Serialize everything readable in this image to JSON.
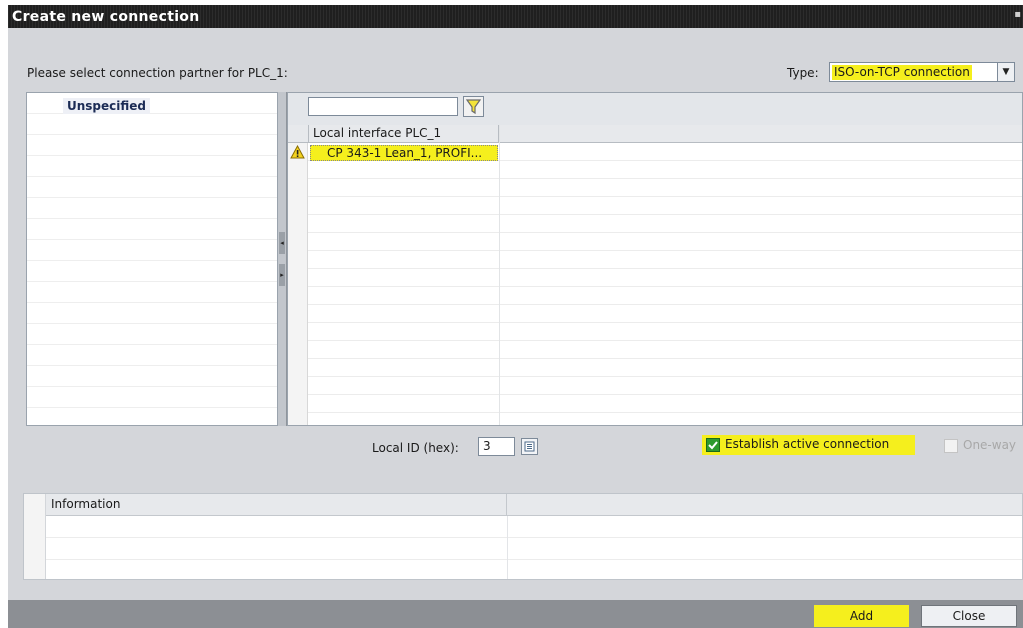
{
  "window": {
    "title": "Create new connection"
  },
  "header": {
    "prompt": "Please select connection partner for PLC_1:",
    "type_label": "Type:",
    "type_value": "ISO-on-TCP connection"
  },
  "partners": {
    "items": [
      {
        "label": "Unspecified"
      }
    ]
  },
  "interfaces": {
    "filter_value": "",
    "column_header": "Local interface PLC_1",
    "rows": [
      {
        "label": "CP 343-1 Lean_1, PROFI..."
      }
    ]
  },
  "settings": {
    "local_id_label": "Local ID (hex):",
    "local_id_value": "3",
    "active_connection_label": "Establish active connection",
    "active_connection_checked": true,
    "oneway_label": "One-way",
    "oneway_checked": false
  },
  "info": {
    "column_header": "Information"
  },
  "buttons": {
    "add": "Add",
    "close": "Close"
  },
  "colors": {
    "highlight": "#f5ef1d",
    "title_bar": "#1f1f1f",
    "dialog_bg": "#d4d6da",
    "check_green": "#2e9a2e"
  }
}
